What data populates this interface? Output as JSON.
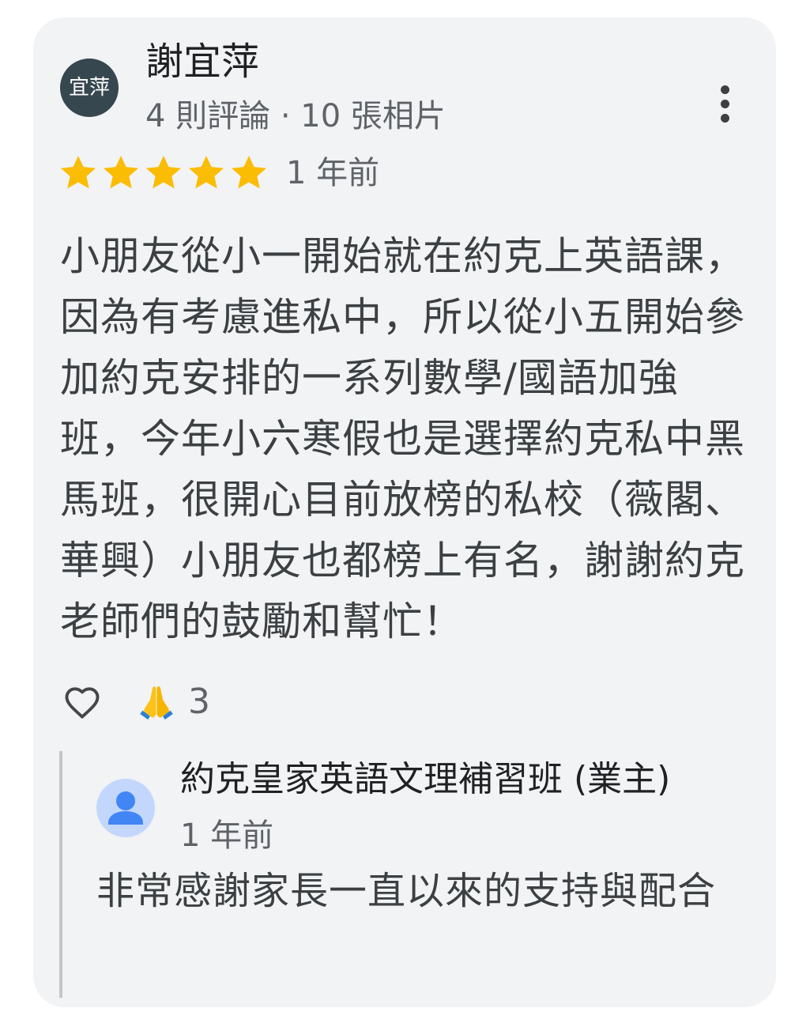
{
  "review": {
    "avatar_text": "宜萍",
    "reviewer_name": "謝宜萍",
    "reviewer_meta": "4 則評論 · 10 張相片",
    "rating": 5,
    "max_rating": 5,
    "date": "1 年前",
    "text": "小朋友從小一開始就在約克上英語課，因為有考慮進私中，所以從小五開始參加約克安排的一系列數學/國語加強班，今年小六寒假也是選擇約克私中黑馬班，很開心目前放榜的私校（薇閣、華興）小朋友也都榜上有名，謝謝約克老師們的鼓勵和幫忙！",
    "reaction_emoji": "🙏",
    "reaction_count": "3"
  },
  "owner_reply": {
    "name": "約克皇家英語文理補習班 (業主)",
    "date": "1 年前",
    "text": "非常感謝家長一直以來的支持與配合"
  },
  "colors": {
    "card_bg": "#f1f3f4",
    "star": "#fbbc04",
    "avatar_bg": "#37474f",
    "owner_avatar": "#4285f4"
  },
  "icons": {
    "more": "more-vert-icon",
    "star": "star-icon",
    "heart": "heart-outline-icon",
    "pray": "folded-hands-icon",
    "owner_avatar": "person-icon"
  }
}
